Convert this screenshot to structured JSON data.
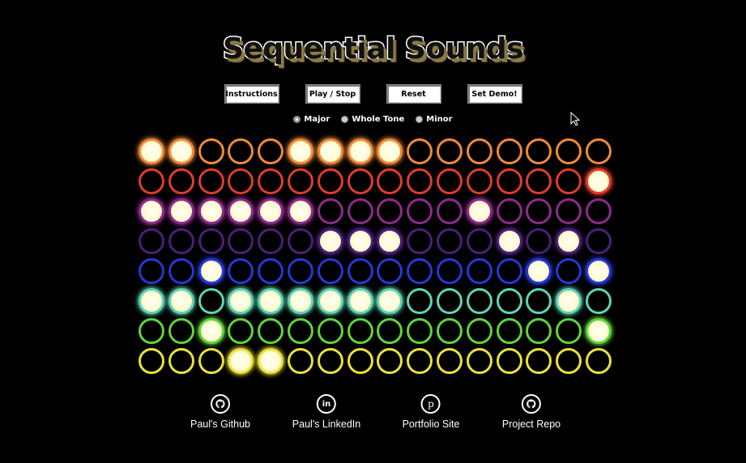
{
  "title": "Sequential Sounds",
  "buttons": {
    "instructions": "Instructions",
    "play_stop": "Play / Stop",
    "reset": "Reset",
    "set_demo": "Set Demo!"
  },
  "scales": [
    {
      "label": "Major",
      "selected": true
    },
    {
      "label": "Whole Tone",
      "selected": false
    },
    {
      "label": "Minor",
      "selected": false
    }
  ],
  "grid": {
    "columns": 16,
    "rows": [
      {
        "color": "#f0893a",
        "active": [
          0,
          1,
          5,
          6,
          7,
          8
        ]
      },
      {
        "color": "#e23b2e",
        "active": [
          15
        ]
      },
      {
        "color": "#8e2a8c",
        "active": [
          0,
          1,
          2,
          3,
          4,
          5,
          11
        ]
      },
      {
        "color": "#4a1f7a",
        "active": [
          6,
          7,
          8,
          12,
          14
        ]
      },
      {
        "color": "#2637d8",
        "active": [
          2,
          13,
          15
        ]
      },
      {
        "color": "#5ed4b4",
        "active": [
          0,
          1,
          3,
          4,
          5,
          6,
          7,
          8,
          14
        ]
      },
      {
        "color": "#5fd43c",
        "active": [
          2,
          15
        ]
      },
      {
        "color": "#eae23b",
        "active": [
          3,
          4
        ]
      }
    ]
  },
  "footer": [
    {
      "label": "Paul's Github",
      "icon": "github-icon"
    },
    {
      "label": "Paul's LinkedIn",
      "icon": "linkedin-icon"
    },
    {
      "label": "Portfolio Site",
      "icon": "portfolio-p-icon"
    },
    {
      "label": "Project Repo",
      "icon": "github-icon"
    }
  ]
}
